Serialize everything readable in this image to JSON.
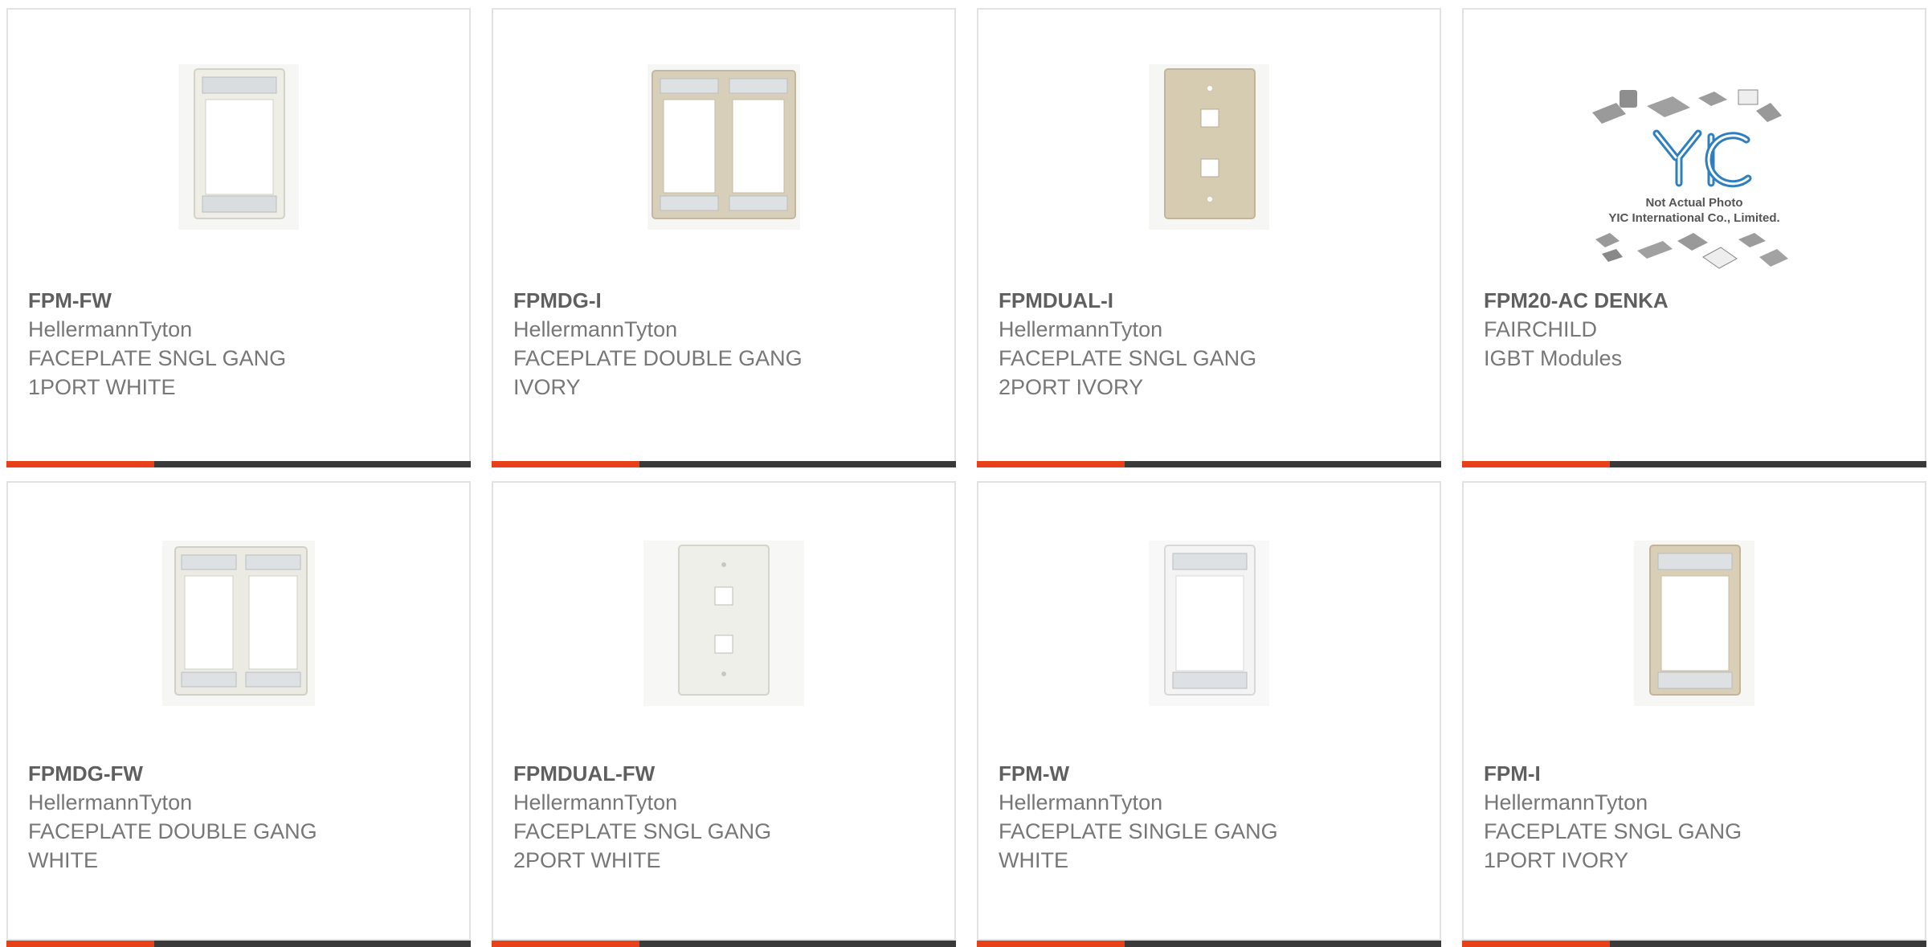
{
  "colors": {
    "accent": "#e8411a",
    "bar": "#3a3a3a",
    "border": "#e2e2e2",
    "text_bold": "#5f5f5f",
    "text": "#777777"
  },
  "products": [
    {
      "part": "FPM-FW",
      "maker": "HellermannTyton",
      "desc": "FACEPLATE SNGL GANG\n1PORT WHITE",
      "image": "faceplate-single-icon"
    },
    {
      "part": "FPMDG-I",
      "maker": "HellermannTyton",
      "desc": "FACEPLATE DOUBLE GANG\nIVORY",
      "image": "faceplate-double-icon"
    },
    {
      "part": "FPMDUAL-I",
      "maker": "HellermannTyton",
      "desc": "FACEPLATE SNGL GANG\n2PORT IVORY",
      "image": "faceplate-two-port-icon"
    },
    {
      "part": "FPM20-AC DENKA",
      "maker": "FAIRCHILD",
      "desc": "IGBT Modules",
      "image": "placeholder-photo-icon",
      "placeholder": {
        "logo": "YIC",
        "line1": "Not Actual Photo",
        "line2": "YIC International Co., Limited."
      }
    },
    {
      "part": "FPMDG-FW",
      "maker": "HellermannTyton",
      "desc": "FACEPLATE DOUBLE GANG\nWHITE",
      "image": "faceplate-double-icon"
    },
    {
      "part": "FPMDUAL-FW",
      "maker": "HellermannTyton",
      "desc": "FACEPLATE SNGL GANG\n2PORT WHITE",
      "image": "faceplate-two-port-icon"
    },
    {
      "part": "FPM-W",
      "maker": "HellermannTyton",
      "desc": "FACEPLATE SINGLE GANG\nWHITE",
      "image": "faceplate-single-icon"
    },
    {
      "part": "FPM-I",
      "maker": "HellermannTyton",
      "desc": "FACEPLATE SNGL GANG\n1PORT IVORY",
      "image": "faceplate-single-icon"
    }
  ]
}
